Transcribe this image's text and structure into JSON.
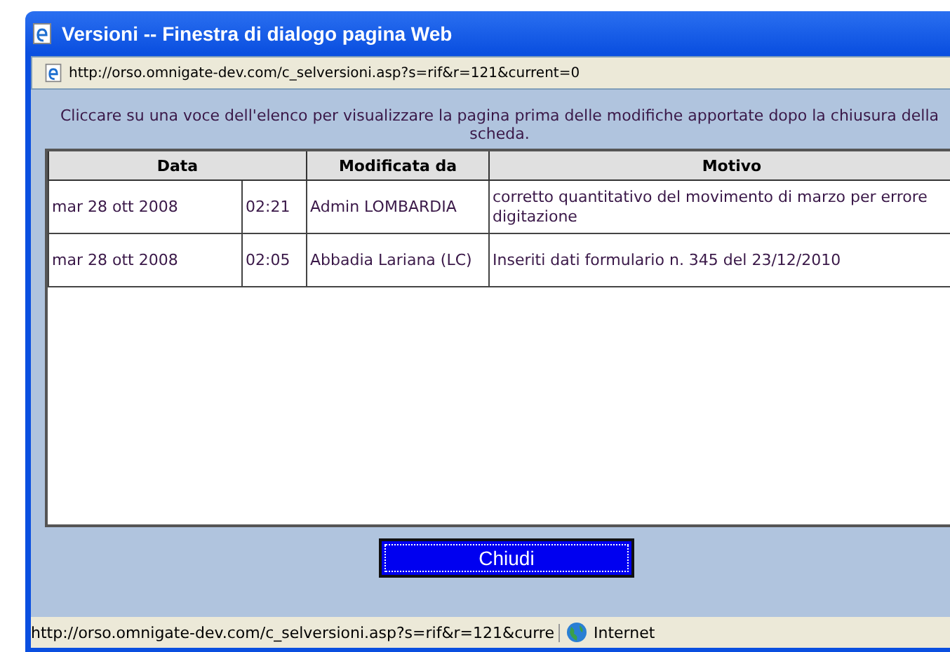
{
  "window": {
    "title": "Versioni -- Finestra di dialogo pagina Web"
  },
  "address_bar": {
    "url": "http://orso.omnigate-dev.com/c_selversioni.asp?s=rif&r=121&current=0"
  },
  "instructions": "Cliccare su una voce dell'elenco per visualizzare la pagina prima delle modifiche apportate dopo la chiusura della scheda.",
  "table": {
    "columns": [
      "Data",
      "Modificata da",
      "Motivo"
    ],
    "rows": [
      {
        "date": "mar 28 ott 2008",
        "time": "02:21",
        "modified_by": "Admin LOMBARDIA",
        "reason": "corretto quantitativo del movimento di marzo per errore digitazione"
      },
      {
        "date": "mar 28 ott 2008",
        "time": "02:05",
        "modified_by": "Abbadia Lariana (LC)",
        "reason": "Inseriti dati formulario n. 345 del 23/12/2010"
      }
    ]
  },
  "buttons": [
    "Chiudi"
  ],
  "status_bar": {
    "url": "http://orso.omnigate-dev.com/c_selversioni.asp?s=rif&r=121&curre",
    "zone": "Internet"
  }
}
